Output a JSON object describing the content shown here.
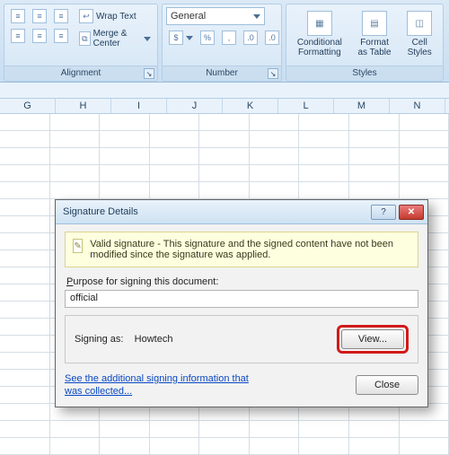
{
  "ribbon": {
    "alignment": {
      "label": "Alignment",
      "wrap_text": "Wrap Text",
      "merge_center": "Merge & Center"
    },
    "number": {
      "label": "Number",
      "format_selected": "General",
      "currency": "$",
      "percent": "%",
      "comma": ","
    },
    "styles": {
      "label": "Styles",
      "conditional": "Conditional\nFormatting",
      "table": "Format\nas Table",
      "cell": "Cell\nStyles"
    }
  },
  "columns": [
    "G",
    "H",
    "I",
    "J",
    "K",
    "L",
    "M",
    "N"
  ],
  "dialog": {
    "title": "Signature Details",
    "info": "Valid signature - This signature and the signed content have not been modified since the signature was applied.",
    "purpose_label_pre": "P",
    "purpose_label_rest": "urpose for signing this document:",
    "purpose_value": "official",
    "signing_as_label": "Signing as:",
    "signing_as_value": "Howtech",
    "view_btn": "View...",
    "link_text": "See the additional signing information that was collected...",
    "close_btn": "Close"
  }
}
